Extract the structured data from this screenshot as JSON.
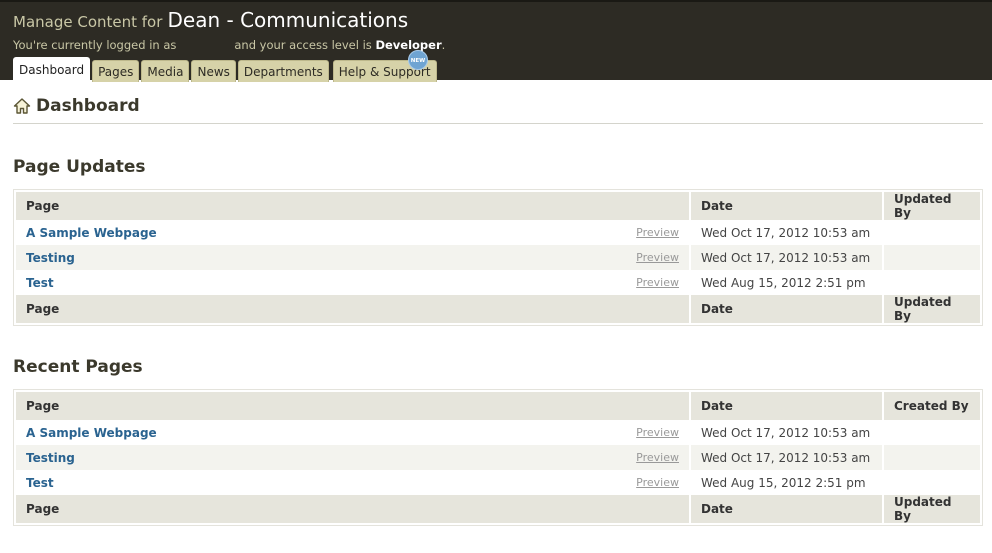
{
  "header": {
    "prefix": "Manage Content for",
    "site_name": "Dean - Communications",
    "login_prefix": "You're currently logged in as",
    "access_text": "and your access level is",
    "access_level": "Developer",
    "access_suffix": ".",
    "new_badge": "NEW"
  },
  "tabs": [
    "Dashboard",
    "Pages",
    "Media",
    "News",
    "Departments",
    "Help & Support"
  ],
  "page_title": "Dashboard",
  "page_updates": {
    "title": "Page Updates",
    "columns": [
      "Page",
      "Date",
      "Updated By"
    ],
    "footer": [
      "Page",
      "Date",
      "Updated By"
    ],
    "rows": [
      {
        "page": "A Sample Webpage",
        "preview": "Preview",
        "date": "Wed Oct 17, 2012 10:53 am",
        "by": ""
      },
      {
        "page": "Testing",
        "preview": "Preview",
        "date": "Wed Oct 17, 2012 10:53 am",
        "by": ""
      },
      {
        "page": "Test",
        "preview": "Preview",
        "date": "Wed Aug 15, 2012 2:51 pm",
        "by": ""
      }
    ]
  },
  "recent_pages": {
    "title": "Recent Pages",
    "columns": [
      "Page",
      "Date",
      "Created By"
    ],
    "footer": [
      "Page",
      "Date",
      "Updated By"
    ],
    "rows": [
      {
        "page": "A Sample Webpage",
        "preview": "Preview",
        "date": "Wed Oct 17, 2012 10:53 am",
        "by": ""
      },
      {
        "page": "Testing",
        "preview": "Preview",
        "date": "Wed Oct 17, 2012 10:53 am",
        "by": ""
      },
      {
        "page": "Test",
        "preview": "Preview",
        "date": "Wed Aug 15, 2012 2:51 pm",
        "by": ""
      }
    ]
  },
  "icons": {
    "home": "home-icon"
  },
  "colors": {
    "header_bg": "#2d2b24",
    "tab_bg": "#d6d2a8",
    "link": "#2a6390",
    "table_header": "#e6e5dc"
  }
}
